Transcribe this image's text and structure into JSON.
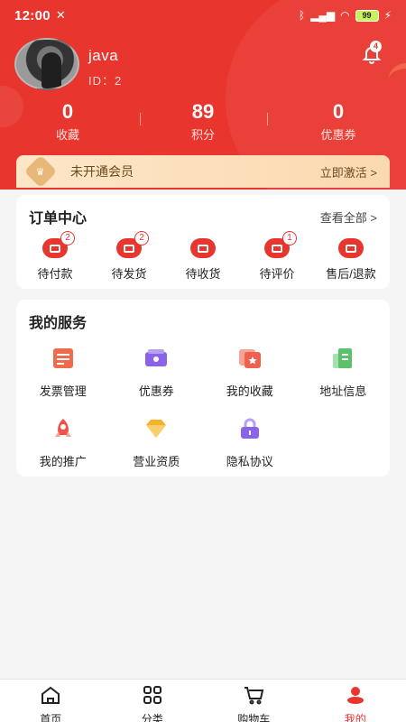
{
  "status_bar": {
    "time": "12:00",
    "battery": "99"
  },
  "profile": {
    "name": "java",
    "id_label": "ID：2",
    "notification_count": "4"
  },
  "stats": [
    {
      "value": "0",
      "label": "收藏"
    },
    {
      "value": "89",
      "label": "积分"
    },
    {
      "value": "0",
      "label": "优惠券"
    }
  ],
  "member": {
    "text": "未开通会员",
    "action": "立即激活 >"
  },
  "orders": {
    "title": "订单中心",
    "more": "查看全部 >",
    "items": [
      {
        "label": "待付款",
        "badge": "2",
        "icon": "wallet-icon"
      },
      {
        "label": "待发货",
        "badge": "2",
        "icon": "package-icon"
      },
      {
        "label": "待收货",
        "badge": "",
        "icon": "truck-icon"
      },
      {
        "label": "待评价",
        "badge": "1",
        "icon": "pen-icon"
      },
      {
        "label": "售后/退款",
        "badge": "",
        "icon": "shield-icon"
      }
    ]
  },
  "services": {
    "title": "我的服务",
    "items": [
      {
        "label": "发票管理",
        "icon": "invoice-icon",
        "color": "#f06b4b"
      },
      {
        "label": "优惠券",
        "icon": "coupon-icon",
        "color": "#8a63e8"
      },
      {
        "label": "我的收藏",
        "icon": "favorites-icon",
        "color": "#f0604e"
      },
      {
        "label": "地址信息",
        "icon": "address-book-icon",
        "color": "#5cc16b"
      },
      {
        "label": "我的推广",
        "icon": "rocket-icon",
        "color": "#f0524a"
      },
      {
        "label": "营业资质",
        "icon": "diamond-icon",
        "color": "#f5b32a"
      },
      {
        "label": "隐私协议",
        "icon": "lock-icon",
        "color": "#8a63e8"
      }
    ]
  },
  "tabbar": {
    "items": [
      {
        "label": "首页",
        "icon": "home-icon"
      },
      {
        "label": "分类",
        "icon": "grid-icon"
      },
      {
        "label": "购物车",
        "icon": "cart-icon"
      },
      {
        "label": "我的",
        "icon": "profile-icon",
        "active": true
      }
    ]
  },
  "colors": {
    "primary": "#e8352e",
    "member_text": "#6b4a1c"
  }
}
